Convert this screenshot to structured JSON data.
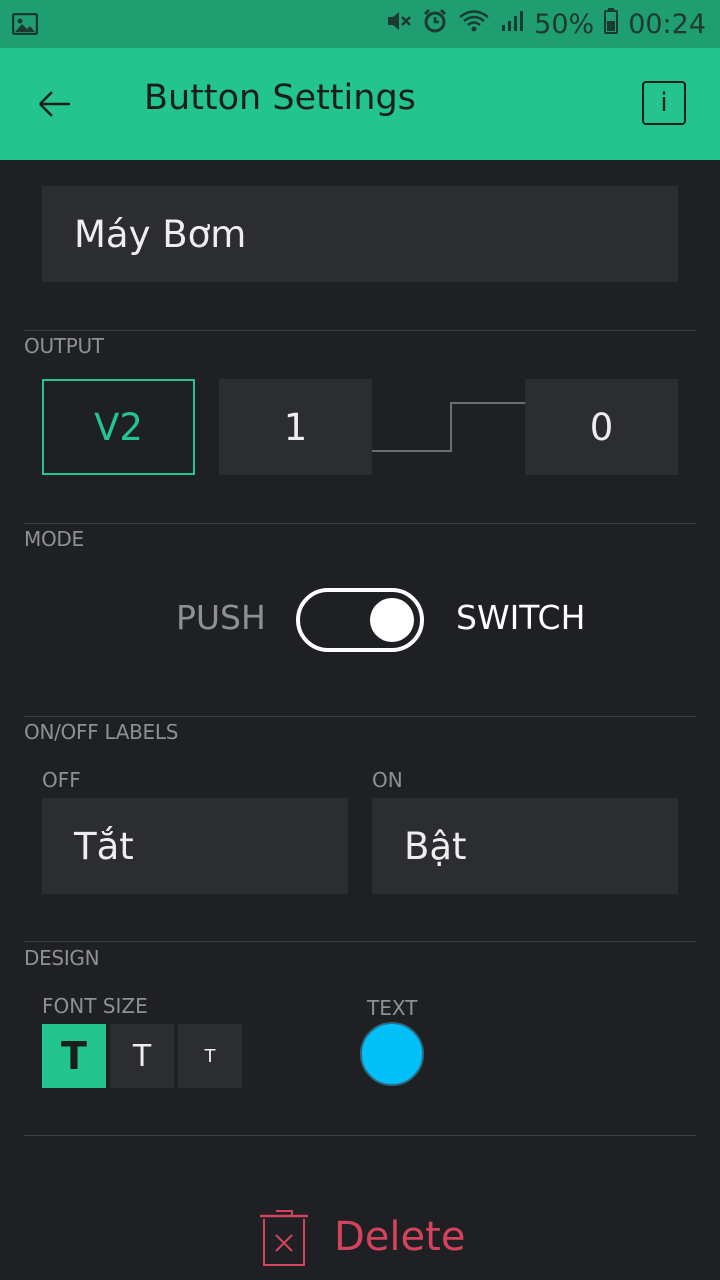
{
  "status_bar": {
    "battery": "50%",
    "time": "00:24",
    "icons": [
      "image-icon",
      "mute-icon",
      "alarm-icon",
      "wifi-icon",
      "signal-icon",
      "battery-icon"
    ]
  },
  "app_bar": {
    "title": "Button Settings",
    "info_label": "i"
  },
  "name_field": {
    "value": "Máy Bơm"
  },
  "output": {
    "section_label": "OUTPUT",
    "pin": "V2",
    "value_start": "1",
    "value_end": "0"
  },
  "mode": {
    "section_label": "MODE",
    "push_label": "PUSH",
    "switch_label": "SWITCH",
    "selected": "SWITCH"
  },
  "labels": {
    "section_label": "ON/OFF LABELS",
    "off_label": "OFF",
    "off_value": "Tắt",
    "on_label": "ON",
    "on_value": "Bật"
  },
  "design": {
    "section_label": "DESIGN",
    "font_size_label": "FONT SIZE",
    "font_sizes": [
      "T",
      "T",
      "T"
    ],
    "selected_font_size": "large",
    "text_label": "TEXT",
    "text_color": "#04c0f8"
  },
  "delete": {
    "label": "Delete",
    "color": "#d3435c"
  },
  "colors": {
    "accent": "#23c48e",
    "background": "#1f2024"
  }
}
